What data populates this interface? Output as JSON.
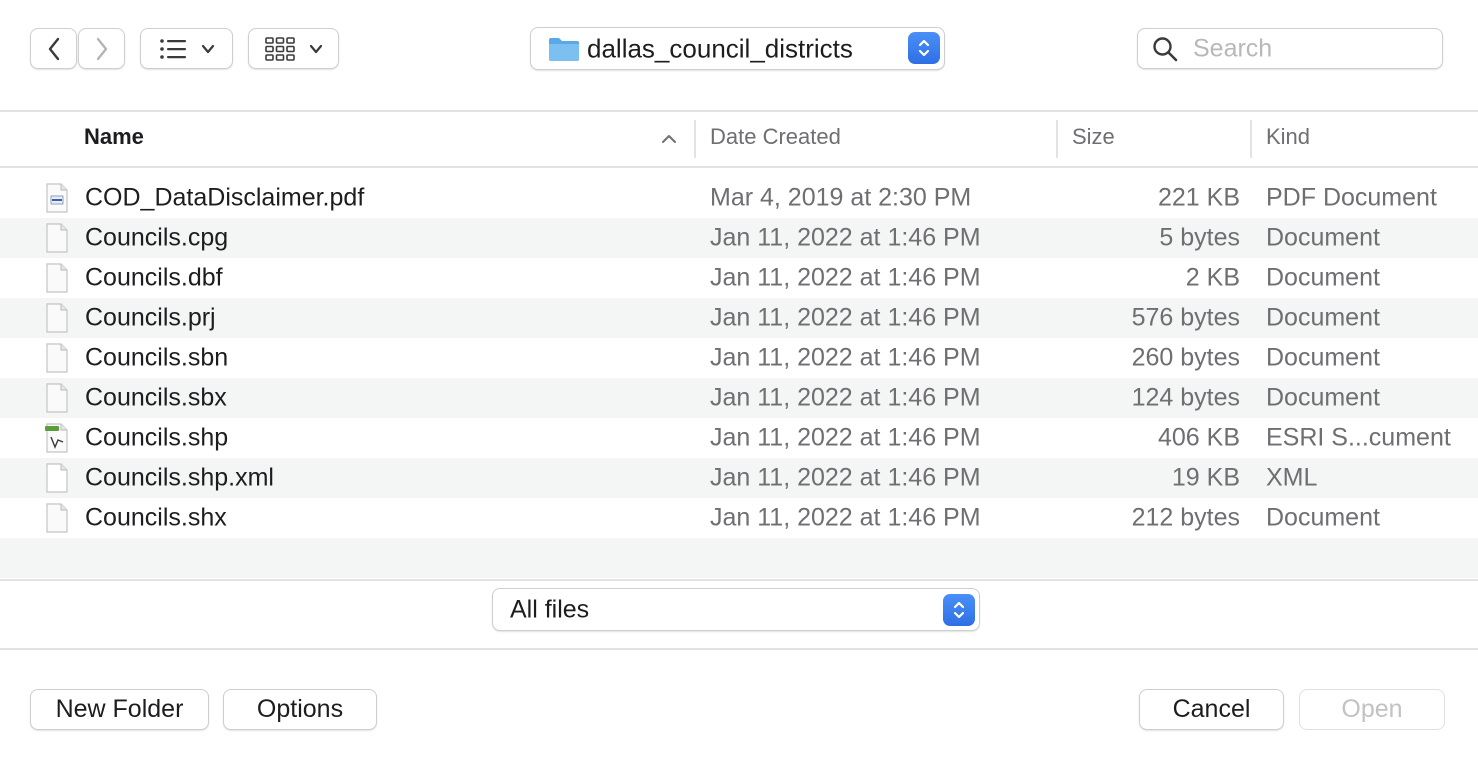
{
  "toolbar": {
    "back_icon": "chevron-left-icon",
    "forward_icon": "chevron-right-icon",
    "list_view_icon": "list-icon",
    "group_icon": "grid-icon",
    "location": "dallas_council_districts",
    "search_placeholder": "Search"
  },
  "columns": {
    "name": "Name",
    "date": "Date Created",
    "size": "Size",
    "kind": "Kind"
  },
  "files": [
    {
      "name": "COD_DataDisclaimer.pdf",
      "date": "Mar 4, 2019 at 2:30 PM",
      "size": "221 KB",
      "kind": "PDF Document",
      "icon": "pdf-file-icon"
    },
    {
      "name": "Councils.cpg",
      "date": "Jan 11, 2022 at 1:46 PM",
      "size": "5 bytes",
      "kind": "Document",
      "icon": "document-icon"
    },
    {
      "name": "Councils.dbf",
      "date": "Jan 11, 2022 at 1:46 PM",
      "size": "2 KB",
      "kind": "Document",
      "icon": "document-icon"
    },
    {
      "name": "Councils.prj",
      "date": "Jan 11, 2022 at 1:46 PM",
      "size": "576 bytes",
      "kind": "Document",
      "icon": "document-icon"
    },
    {
      "name": "Councils.sbn",
      "date": "Jan 11, 2022 at 1:46 PM",
      "size": "260 bytes",
      "kind": "Document",
      "icon": "document-icon"
    },
    {
      "name": "Councils.sbx",
      "date": "Jan 11, 2022 at 1:46 PM",
      "size": "124 bytes",
      "kind": "Document",
      "icon": "document-icon"
    },
    {
      "name": "Councils.shp",
      "date": "Jan 11, 2022 at 1:46 PM",
      "size": "406 KB",
      "kind": "ESRI S...cument",
      "icon": "shp-file-icon"
    },
    {
      "name": "Councils.shp.xml",
      "date": "Jan 11, 2022 at 1:46 PM",
      "size": "19 KB",
      "kind": "XML",
      "icon": "xml-file-icon"
    },
    {
      "name": "Councils.shx",
      "date": "Jan 11, 2022 at 1:46 PM",
      "size": "212 bytes",
      "kind": "Document",
      "icon": "document-icon"
    }
  ],
  "filter": {
    "selected": "All files"
  },
  "buttons": {
    "new_folder": "New Folder",
    "options": "Options",
    "cancel": "Cancel",
    "open": "Open"
  },
  "colors": {
    "accent": "#2f6fe6",
    "folder": "#5aa8e8",
    "row_alt": "#f4f5f5"
  }
}
